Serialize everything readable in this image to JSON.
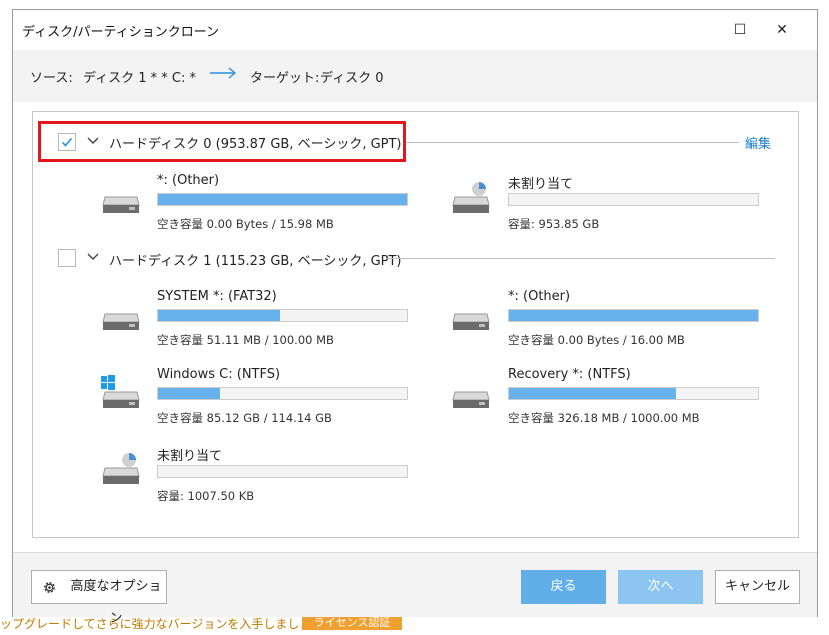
{
  "window": {
    "title": "ディスク/パーティションクローン",
    "maximize_glyph": "☐",
    "close_glyph": "✕"
  },
  "source_bar": {
    "source_label": "ソース:",
    "source_value": "ディスク 1 * * C: *",
    "target_label": "ターゲット:",
    "target_value": "ディスク 0"
  },
  "edit_link": "編集",
  "disks": [
    {
      "title": "ハードディスク 0 (953.87 GB, ベーシック, GPT)",
      "checked": true,
      "partitions": [
        {
          "name": "*: (Other)",
          "caption": "空き容量 0.00 Bytes / 15.98 MB",
          "fill_fraction": 1.0,
          "icon": "drive-icon"
        },
        {
          "name": "未割り当て",
          "caption": "容量: 953.85 GB",
          "fill_fraction": 0.0,
          "icon": "unallocated-drive-icon"
        }
      ]
    },
    {
      "title": "ハードディスク 1 (115.23 GB, ベーシック, GPT)",
      "checked": false,
      "partitions": [
        {
          "name": "SYSTEM *: (FAT32)",
          "caption": "空き容量 51.11 MB / 100.00 MB",
          "fill_fraction": 0.49,
          "icon": "drive-icon"
        },
        {
          "name": "*: (Other)",
          "caption": "空き容量 0.00 Bytes / 16.00 MB",
          "fill_fraction": 1.0,
          "icon": "drive-icon"
        },
        {
          "name": "Windows C: (NTFS)",
          "caption": "空き容量 85.12 GB / 114.14 GB",
          "fill_fraction": 0.25,
          "icon": "windows-drive-icon"
        },
        {
          "name": "Recovery *: (NTFS)",
          "caption": "空き容量 326.18 MB / 1000.00 MB",
          "fill_fraction": 0.67,
          "icon": "drive-icon"
        },
        {
          "name": "未割り当て",
          "caption": "容量: 1007.50 KB",
          "fill_fraction": 0.0,
          "icon": "unallocated-drive-icon"
        }
      ]
    }
  ],
  "footer": {
    "advanced_label": "高度なオプション",
    "back_label": "戻る",
    "next_label": "次へ",
    "cancel_label": "キャンセル"
  },
  "bottom_strip": {
    "text": "ップグレードしてさらに強力なバージョンを入手しましょう。",
    "badge": "ライセンス認証"
  },
  "colors": {
    "accent": "#2b8fd9",
    "bar_fill": "#67b1ec",
    "highlight_border": "#e3161b",
    "back_button": "#62aee8",
    "next_button": "#8cc6f0",
    "link": "#1a7cc9"
  }
}
